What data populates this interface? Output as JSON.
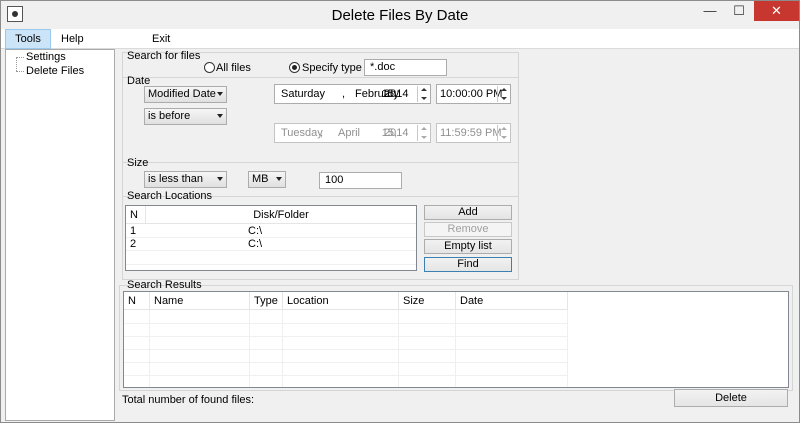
{
  "window": {
    "title": "Delete Files By Date",
    "minimize": "—",
    "maximize": "☐",
    "close": "✕"
  },
  "menu": {
    "tools": "Tools",
    "help": "Help",
    "exit": "Exit"
  },
  "tree": {
    "items": [
      {
        "label": "Settings"
      },
      {
        "label": "Delete Files"
      }
    ]
  },
  "search_files": {
    "label": "Search for files",
    "all_files": "All files",
    "specify_type": "Specify type",
    "type_value": "*.doc",
    "selected": "specify_type"
  },
  "date": {
    "label": "Date",
    "date_field": "Modified Date",
    "condition": "is before",
    "date1": {
      "weekday": "Saturday",
      "sep": ",",
      "month": "February",
      "day": "15,",
      "year": "2014"
    },
    "time1": "10:00:00 PM",
    "date2": {
      "weekday": "Tuesday",
      "sep": ",",
      "month": "April",
      "day": "15,",
      "year": "2014"
    },
    "time2": "11:59:59 PM"
  },
  "size": {
    "label": "Size",
    "condition": "is less than",
    "unit": "MB",
    "value": "100"
  },
  "locations": {
    "label": "Search Locations",
    "col_n": "N",
    "col_path": "Disk/Folder",
    "rows": [
      {
        "n": "1",
        "path": "C:\\"
      },
      {
        "n": "2",
        "path": "C:\\"
      }
    ],
    "add": "Add",
    "remove": "Remove",
    "empty": "Empty list",
    "find": "Find"
  },
  "results": {
    "label": "Search Results",
    "columns": [
      "N",
      "Name",
      "Type",
      "Location",
      "Size",
      "Date"
    ],
    "total_label": "Total number of found files:",
    "delete": "Delete"
  }
}
